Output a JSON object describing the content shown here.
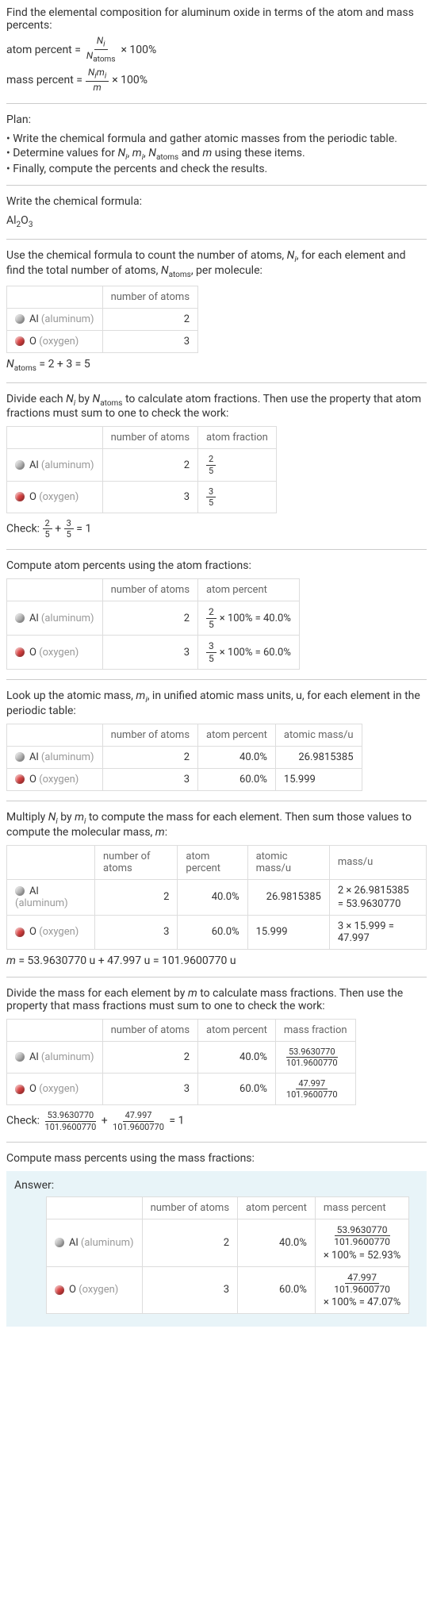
{
  "intro": {
    "line1": "Find the elemental composition for aluminum oxide in terms of the atom and mass percents:",
    "atom_percent_label": "atom percent =",
    "atom_percent_num": "N",
    "atom_percent_num_sub": "i",
    "atom_percent_den": "N",
    "atom_percent_den_sub": "atoms",
    "times100": "× 100%",
    "mass_percent_label": "mass percent =",
    "mass_percent_num": "N",
    "mass_percent_num_sub_i": "i",
    "mass_percent_num_m": "m",
    "mass_percent_den": "m"
  },
  "plan": {
    "title": "Plan:",
    "b1": "• Write the chemical formula and gather atomic masses from the periodic table.",
    "b2_a": "• Determine values for ",
    "b2_b": " using these items.",
    "b3": "• Finally, compute the percents and check the results.",
    "vars": "N_i, m_i, N_atoms and m"
  },
  "s1": {
    "text": "Write the chemical formula:",
    "formula": "Al₂O₃"
  },
  "s2": {
    "text1": "Use the chemical formula to count the number of atoms, ",
    "text2": ", for each element and find the total number of atoms, ",
    "text3": ", per molecule:",
    "hdr_atoms": "number of atoms",
    "al_label": "Al",
    "al_gray": "(aluminum)",
    "o_label": "O",
    "o_gray": "(oxygen)",
    "al_n": "2",
    "o_n": "3",
    "sum": "N",
    "sum_sub": "atoms",
    "sum_eq": " = 2 + 3 = 5"
  },
  "s3": {
    "text1": "Divide each ",
    "text2": " by ",
    "text3": " to calculate atom fractions. Then use the property that atom fractions must sum to one to check the work:",
    "hdr_frac": "atom fraction",
    "al_num": "2",
    "al_den": "5",
    "o_num": "3",
    "o_den": "5",
    "check_label": "Check: ",
    "check_eq": " = 1"
  },
  "s4": {
    "text": "Compute atom percents using the atom fractions:",
    "hdr_pct": "atom percent",
    "al_pct": " × 100% = 40.0%",
    "o_pct": " × 100% = 60.0%"
  },
  "s5": {
    "text1": "Look up the atomic mass, ",
    "text2": ", in unified atomic mass units, u, for each element in the periodic table:",
    "hdr_mass": "atomic mass/u",
    "al_pct_v": "40.0%",
    "o_pct_v": "60.0%",
    "al_mass": "26.9815385",
    "o_mass": "15.999"
  },
  "s6": {
    "text1": "Multiply ",
    "text2": " by ",
    "text3": " to compute the mass for each element. Then sum those values to compute the molecular mass, ",
    "text4": ":",
    "hdr_massu": "mass/u",
    "al_calc1": "2 × 26.9815385",
    "al_calc2": "= 53.9630770",
    "o_calc": "3 × 15.999 = 47.997",
    "sum": "m = 53.9630770 u + 47.997 u = 101.9600770 u"
  },
  "s7": {
    "text1": "Divide the mass for each element by ",
    "text2": " to calculate mass fractions. Then use the property that mass fractions must sum to one to check the work:",
    "hdr_mf": "mass fraction",
    "al_num": "53.9630770",
    "al_den": "101.9600770",
    "o_num": "47.997",
    "o_den": "101.9600770",
    "check_label": "Check: ",
    "check_eq": " = 1"
  },
  "s8": {
    "text": "Compute mass percents using the mass fractions:"
  },
  "answer": {
    "label": "Answer:",
    "hdr_mp": "mass percent",
    "al_num": "53.9630770",
    "al_den": "101.9600770",
    "al_pct": "× 100% = 52.93%",
    "o_num": "47.997",
    "o_den": "101.9600770",
    "o_pct": "× 100% = 47.07%"
  },
  "colors": {
    "al": "#b8b8b8",
    "o": "#d84040"
  },
  "chart_data": {
    "type": "table",
    "elements": [
      {
        "symbol": "Al",
        "name": "aluminum",
        "n_atoms": 2,
        "atom_fraction": "2/5",
        "atom_percent": 40.0,
        "atomic_mass_u": 26.9815385,
        "mass_u": 53.963077,
        "mass_fraction_num": 53.963077,
        "mass_fraction_den": 101.960077,
        "mass_percent": 52.93
      },
      {
        "symbol": "O",
        "name": "oxygen",
        "n_atoms": 3,
        "atom_fraction": "3/5",
        "atom_percent": 60.0,
        "atomic_mass_u": 15.999,
        "mass_u": 47.997,
        "mass_fraction_num": 47.997,
        "mass_fraction_den": 101.960077,
        "mass_percent": 47.07
      }
    ],
    "n_atoms_total": 5,
    "molecular_mass_u": 101.960077
  }
}
